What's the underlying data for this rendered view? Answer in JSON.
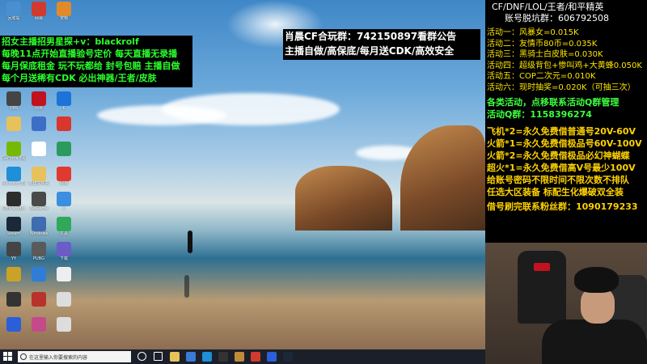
{
  "desktop": {
    "icons": [
      {
        "label": "回收站",
        "name": "recycle-bin-icon",
        "color": "#4a8fd0"
      },
      {
        "label": "网易",
        "name": "app-red-icon",
        "color": "#d13b2f"
      },
      {
        "label": "宠物",
        "name": "pet-icon",
        "color": "#e08a2b"
      },
      {
        "label": "OBS",
        "name": "app-icon",
        "color": "#444"
      },
      {
        "label": "网易",
        "name": "netease-icon",
        "color": "#c1121f"
      },
      {
        "label": "K",
        "name": "k-app-icon",
        "color": "#1e73d8"
      },
      {
        "label": "",
        "name": "folder-icon",
        "color": "#e7c15a"
      },
      {
        "label": "",
        "name": "doc-icon",
        "color": "#3c6ec8"
      },
      {
        "label": "",
        "name": "app2-icon",
        "color": "#d9362c"
      },
      {
        "label": "GeForce Experience",
        "name": "geforce-icon",
        "color": "#76b900"
      },
      {
        "label": "",
        "name": "doc2-icon",
        "color": "#ffffff"
      },
      {
        "label": "",
        "name": "green-app-icon",
        "color": "#2a9b5c"
      },
      {
        "label": "Microsoft Edge",
        "name": "edge-icon",
        "color": "#1e8fd8"
      },
      {
        "label": "新建文件夹",
        "name": "folder2-icon",
        "color": "#e7c15a"
      },
      {
        "label": "网易",
        "name": "cloud-music-icon",
        "color": "#e2392f"
      },
      {
        "label": "OBS Studio",
        "name": "obs-icon",
        "color": "#2c2c2c"
      },
      {
        "label": "WeGame",
        "name": "wegame-icon",
        "color": "#4a4a4a"
      },
      {
        "label": "e",
        "name": "ie-icon",
        "color": "#3a8fe0"
      },
      {
        "label": "Steam",
        "name": "steam-icon",
        "color": "#1b2838"
      },
      {
        "label": "Windows",
        "name": "windows-app-icon",
        "color": "#3f6bb0"
      },
      {
        "label": "工具",
        "name": "tool-icon",
        "color": "#2fa85a"
      },
      {
        "label": "YY",
        "name": "yy-icon",
        "color": "#444"
      },
      {
        "label": "PUBG",
        "name": "pubg-icon",
        "color": "#5a5a5a"
      },
      {
        "label": "下载",
        "name": "download-icon",
        "color": "#6b5cc8"
      },
      {
        "label": "",
        "name": "gold-app-icon",
        "color": "#c9a227"
      },
      {
        "label": "",
        "name": "globe-icon",
        "color": "#2f7dd6"
      },
      {
        "label": "",
        "name": "file-icon",
        "color": "#eeeeee"
      },
      {
        "label": "",
        "name": "dark-app-icon",
        "color": "#333"
      },
      {
        "label": "",
        "name": "red-app-icon",
        "color": "#b8332b"
      },
      {
        "label": "",
        "name": "file2-icon",
        "color": "#dddddd"
      },
      {
        "label": "",
        "name": "shield-app-icon",
        "color": "#2b5fd9"
      },
      {
        "label": "",
        "name": "pink-app-icon",
        "color": "#c44a8a"
      },
      {
        "label": "",
        "name": "file3-icon",
        "color": "#dddddd"
      },
      {
        "label": "CPU",
        "name": "cpu-z-icon",
        "color": "#444"
      },
      {
        "label": "WPS Office",
        "name": "wps-icon",
        "color": "#d13b2f"
      },
      {
        "label": "Google Chrome",
        "name": "chrome-icon",
        "color": "#3b8f3b"
      },
      {
        "label": "",
        "name": "yellow-app-icon",
        "color": "#e0a020"
      },
      {
        "label": "",
        "name": "cartoon-icon",
        "color": "#f0c020"
      },
      {
        "label": "",
        "name": "colorful-icon",
        "color": "#e85a9a"
      },
      {
        "label": "",
        "name": "black-app-icon",
        "color": "#111"
      }
    ]
  },
  "overlay_left": {
    "lines": [
      "招女主播招男星探+v：blackrolf",
      "每晚11点开始直播验号定价 每天直播无录播",
      "每月保底租金 玩不玩都给 封号包赔 主播自做",
      "每个月送稀有CDK 必出神器/王者/皮肤"
    ]
  },
  "overlay_center": {
    "lines": [
      "肖晨CF合玩群：742150897看群公告",
      "主播自做/高保底/每月送CDK/高效安全"
    ]
  },
  "right_panel": {
    "header1": "CF/DNF/LOL/王者/和平精英",
    "header2": "账号脱坑群：606792508",
    "activities": [
      "活动一：风暴女=0.015K",
      "活动二：友情币80币=0.035K",
      "活动三：黑骑士白皮肤=0.030K",
      "活动四：超级背包+惨叫鸡+大黄蜂0.050K",
      "活动五：COP二次元=0.010K",
      "活动六：现时抽奖=0.020K（可抽三次）"
    ],
    "contact1": "各类活动，点移联系活动Q群管理",
    "contact2": "活动Q群：1158396274",
    "deals": [
      "飞机*2=永久免费借普通号20V-60V",
      "火箭*1=永久免费借极品号60V-100V",
      "火箭*2=永久免费借极品必幻神蝴蝶",
      "超火*1=永久免费借高V号最少100V",
      "给账号密码不限时间不限次数不排队",
      "任选大区装备 标配生化爆破双全装"
    ],
    "fans": "借号刷完联系粉丝群：1090179233"
  },
  "taskbar": {
    "search_placeholder": "在这里输入你要搜索的内容",
    "pinned": [
      {
        "name": "cortana-icon",
        "color": "#ffffff"
      },
      {
        "name": "task-view-icon",
        "color": "#ffffff"
      },
      {
        "name": "explorer-icon",
        "color": "#e7c15a"
      },
      {
        "name": "store-icon",
        "color": "#3a7bd5"
      },
      {
        "name": "edge-taskbar-icon",
        "color": "#1e8fd8"
      },
      {
        "name": "obs-taskbar-icon",
        "color": "#333"
      },
      {
        "name": "game-taskbar-icon",
        "color": "#c08a3a"
      },
      {
        "name": "netease-taskbar-icon",
        "color": "#d13b2f"
      },
      {
        "name": "app-taskbar-icon",
        "color": "#2b5fd9"
      },
      {
        "name": "steam-taskbar-icon",
        "color": "#1b2838"
      }
    ]
  }
}
